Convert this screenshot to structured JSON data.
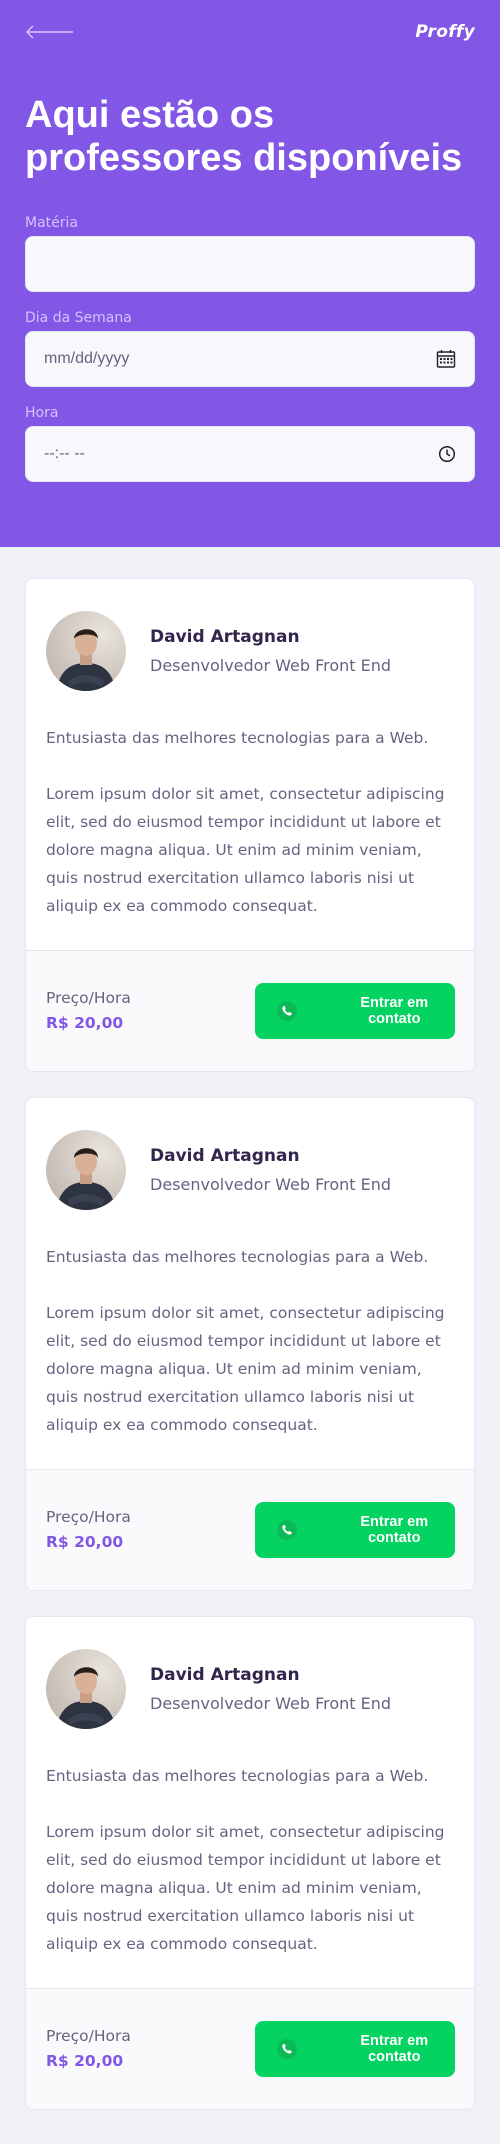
{
  "header": {
    "back_icon": "arrow-left-icon",
    "logo": "Proffy",
    "title": "Aqui estão os professores disponíveis"
  },
  "filters": {
    "subject": {
      "label": "Matéria",
      "value": ""
    },
    "weekday": {
      "label": "Dia da Semana",
      "value": "mm/dd/yyyy",
      "icon": "calendar-icon"
    },
    "time": {
      "label": "Hora",
      "value": "--:-- --",
      "icon": "clock-icon"
    }
  },
  "teachers": [
    {
      "name": "David Artagnan",
      "subject": "Desenvolvedor Web Front End",
      "bio_1": "Entusiasta das melhores tecnologias para a Web.",
      "bio_2": "Lorem ipsum dolor sit amet, consectetur adipiscing elit, sed do eiusmod tempor incididunt ut labore et dolore magna aliqua. Ut enim ad minim veniam, quis nostrud exercitation ullamco laboris nisi ut aliquip ex ea commodo consequat.",
      "price_label": "Preço/Hora",
      "price": "R$ 20,00",
      "cta": "Entrar em contato"
    },
    {
      "name": "David Artagnan",
      "subject": "Desenvolvedor Web Front End",
      "bio_1": "Entusiasta das melhores tecnologias para a Web.",
      "bio_2": "Lorem ipsum dolor sit amet, consectetur adipiscing elit, sed do eiusmod tempor incididunt ut labore et dolore magna aliqua. Ut enim ad minim veniam, quis nostrud exercitation ullamco laboris nisi ut aliquip ex ea commodo consequat.",
      "price_label": "Preço/Hora",
      "price": "R$ 20,00",
      "cta": "Entrar em contato"
    },
    {
      "name": "David Artagnan",
      "subject": "Desenvolvedor Web Front End",
      "bio_1": "Entusiasta das melhores tecnologias para a Web.",
      "bio_2": "Lorem ipsum dolor sit amet, consectetur adipiscing elit, sed do eiusmod tempor incididunt ut labore et dolore magna aliqua. Ut enim ad minim veniam, quis nostrud exercitation ullamco laboris nisi ut aliquip ex ea commodo consequat.",
      "price_label": "Preço/Hora",
      "price": "R$ 20,00",
      "cta": "Entrar em contato"
    }
  ],
  "colors": {
    "primary": "#8257E5",
    "background": "#F0F0F7",
    "secondary": "#04D361",
    "text_title": "#32264D",
    "text_base": "#6A6180"
  }
}
